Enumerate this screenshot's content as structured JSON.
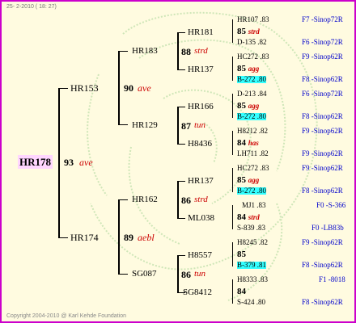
{
  "header": "25- 2-2010 ( 18: 27)",
  "footer": "Copyright 2004-2010 @ Karl Kehde Foundation",
  "root": {
    "name": "HR178",
    "num": "93",
    "label": "ave"
  },
  "gen1": [
    {
      "name": "HR153",
      "num": "90",
      "label": "ave"
    },
    {
      "name": "HR174",
      "num": "89",
      "label": "aebl"
    }
  ],
  "gen2": [
    {
      "name": "HR183",
      "num": "88",
      "label": "strd"
    },
    {
      "name": "HR129",
      "num": "87",
      "label": "tun"
    },
    {
      "name": "HR162",
      "num": "86",
      "label": "strd"
    },
    {
      "name": "SG087",
      "num": "86",
      "label": "tun"
    }
  ],
  "gen3": [
    {
      "name": "HR181",
      "num": "85",
      "label": "strd"
    },
    {
      "name": "HR137",
      "num": "85",
      "label": "agg"
    },
    {
      "name": "HR166",
      "num": "85",
      "label": "agg"
    },
    {
      "name": "H8436",
      "num": "84",
      "label": "has"
    },
    {
      "name": "HR137",
      "num": "85",
      "label": "agg"
    },
    {
      "name": "ML038",
      "num": "84",
      "label": "strd"
    },
    {
      "name": "H8557",
      "num": "85",
      "label": ""
    },
    {
      "name": "SG8412",
      "num": "84",
      "label": ""
    }
  ],
  "gen4": [
    {
      "name": "HR107",
      "score": ".83",
      "ref": "F7 -Sinop72R"
    },
    {
      "name": "D-135",
      "score": ".82",
      "ref": "F6 -Sinop72R"
    },
    {
      "name": "HC272",
      "score": ".83",
      "ref": "F9 -Sinop62R"
    },
    {
      "name": "B-272",
      "score": ".80",
      "ref": "F8 -Sinop62R"
    },
    {
      "name": "D-213",
      "score": ".84",
      "ref": "F6 -Sinop72R"
    },
    {
      "name": "B-272",
      "score": ".80",
      "ref": "F8 -Sinop62R"
    },
    {
      "name": "H8212",
      "score": ".82",
      "ref": "F9 -Sinop62R"
    },
    {
      "name": "LH711",
      "score": ".82",
      "ref": "F9 -Sinop62R"
    },
    {
      "name": "HC272",
      "score": ".83",
      "ref": "F9 -Sinop62R"
    },
    {
      "name": "B-272",
      "score": ".80",
      "ref": "F8 -Sinop62R"
    },
    {
      "name": "MJ1",
      "score": ".83",
      "ref": "F0 -S-366"
    },
    {
      "name": "S-839",
      "score": ".83",
      "ref": "F0 -LB83b"
    },
    {
      "name": "H8245",
      "score": ".82",
      "ref": "F9 -Sinop62R"
    },
    {
      "name": "B-379",
      "score": ".81",
      "ref": "F8 -Sinop62R"
    },
    {
      "name": "H8333",
      "score": ".83",
      "ref": "F1 -8018"
    },
    {
      "name": "S-424",
      "score": ".80",
      "ref": "F8 -Sinop62R"
    }
  ]
}
